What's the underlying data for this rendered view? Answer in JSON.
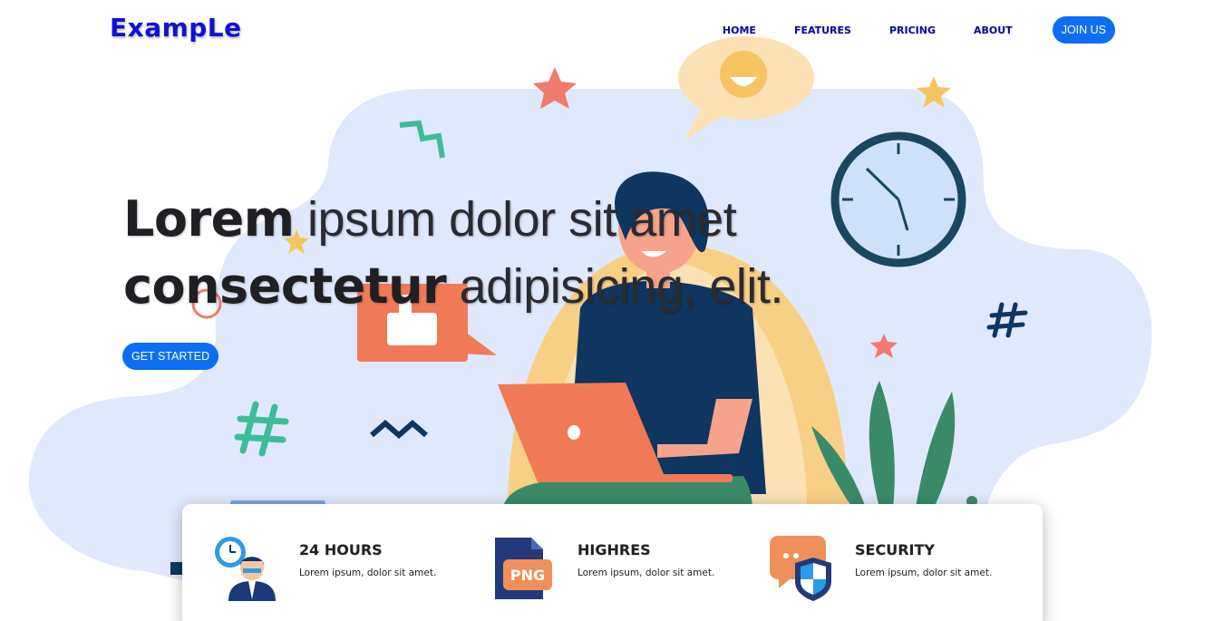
{
  "brand": {
    "logo_text": "ExampLe",
    "primary_color": "#0d6ef2",
    "logo_color": "#1010d8"
  },
  "nav": {
    "items": [
      "HOME",
      "FEATURES",
      "PRICING",
      "ABOUT"
    ],
    "join_label": "JOIN US"
  },
  "hero": {
    "title_bold_1": "Lorem",
    "title_rest_1": " ipsum dolor sit amet",
    "title_bold_2": "consectetur",
    "title_rest_2": " adipisicing, elit.",
    "cta_label": "GET STARTED",
    "illustration": "person-with-laptop-illustration"
  },
  "features": [
    {
      "icon": "support-agent-icon",
      "title": "24 HOURS",
      "desc": "Lorem ipsum, dolor sit amet."
    },
    {
      "icon": "png-file-icon",
      "title": "HIGHRES",
      "desc": "Lorem ipsum, dolor sit amet.",
      "icon_text": "PNG"
    },
    {
      "icon": "security-shield-icon",
      "title": "SECURITY",
      "desc": "Lorem ipsum, dolor sit amet."
    }
  ]
}
